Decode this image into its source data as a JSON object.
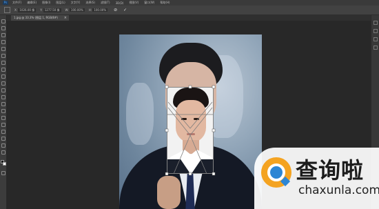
{
  "app": {
    "logo_text": "Ps",
    "menu": [
      "文件(F)",
      "编辑(E)",
      "图像(I)",
      "图层(L)",
      "文字(Y)",
      "选择(S)",
      "滤镜(T)",
      "3D(D)",
      "视图(V)",
      "窗口(W)",
      "帮助(H)"
    ]
  },
  "options_bar": {
    "x_label": "X:",
    "x_value": "1026.00 像",
    "y_label": "Y:",
    "y_value": "1277.50 像",
    "w_label": "W:",
    "w_value": "100.00%",
    "h_label": "H:",
    "h_value": "100.00%",
    "cancel_symbol": "⊘",
    "commit_symbol": "✓"
  },
  "document": {
    "tab_title": "1.jpg @ 33.3% (图层 1, RGB/8#)",
    "close_symbol": "×"
  },
  "watermark": {
    "title": "查询啦",
    "url": "chaxunla.com"
  },
  "colors": {
    "app_bg": "#282828",
    "accent_blue": "#2d86d4",
    "accent_orange": "#f4a321"
  }
}
